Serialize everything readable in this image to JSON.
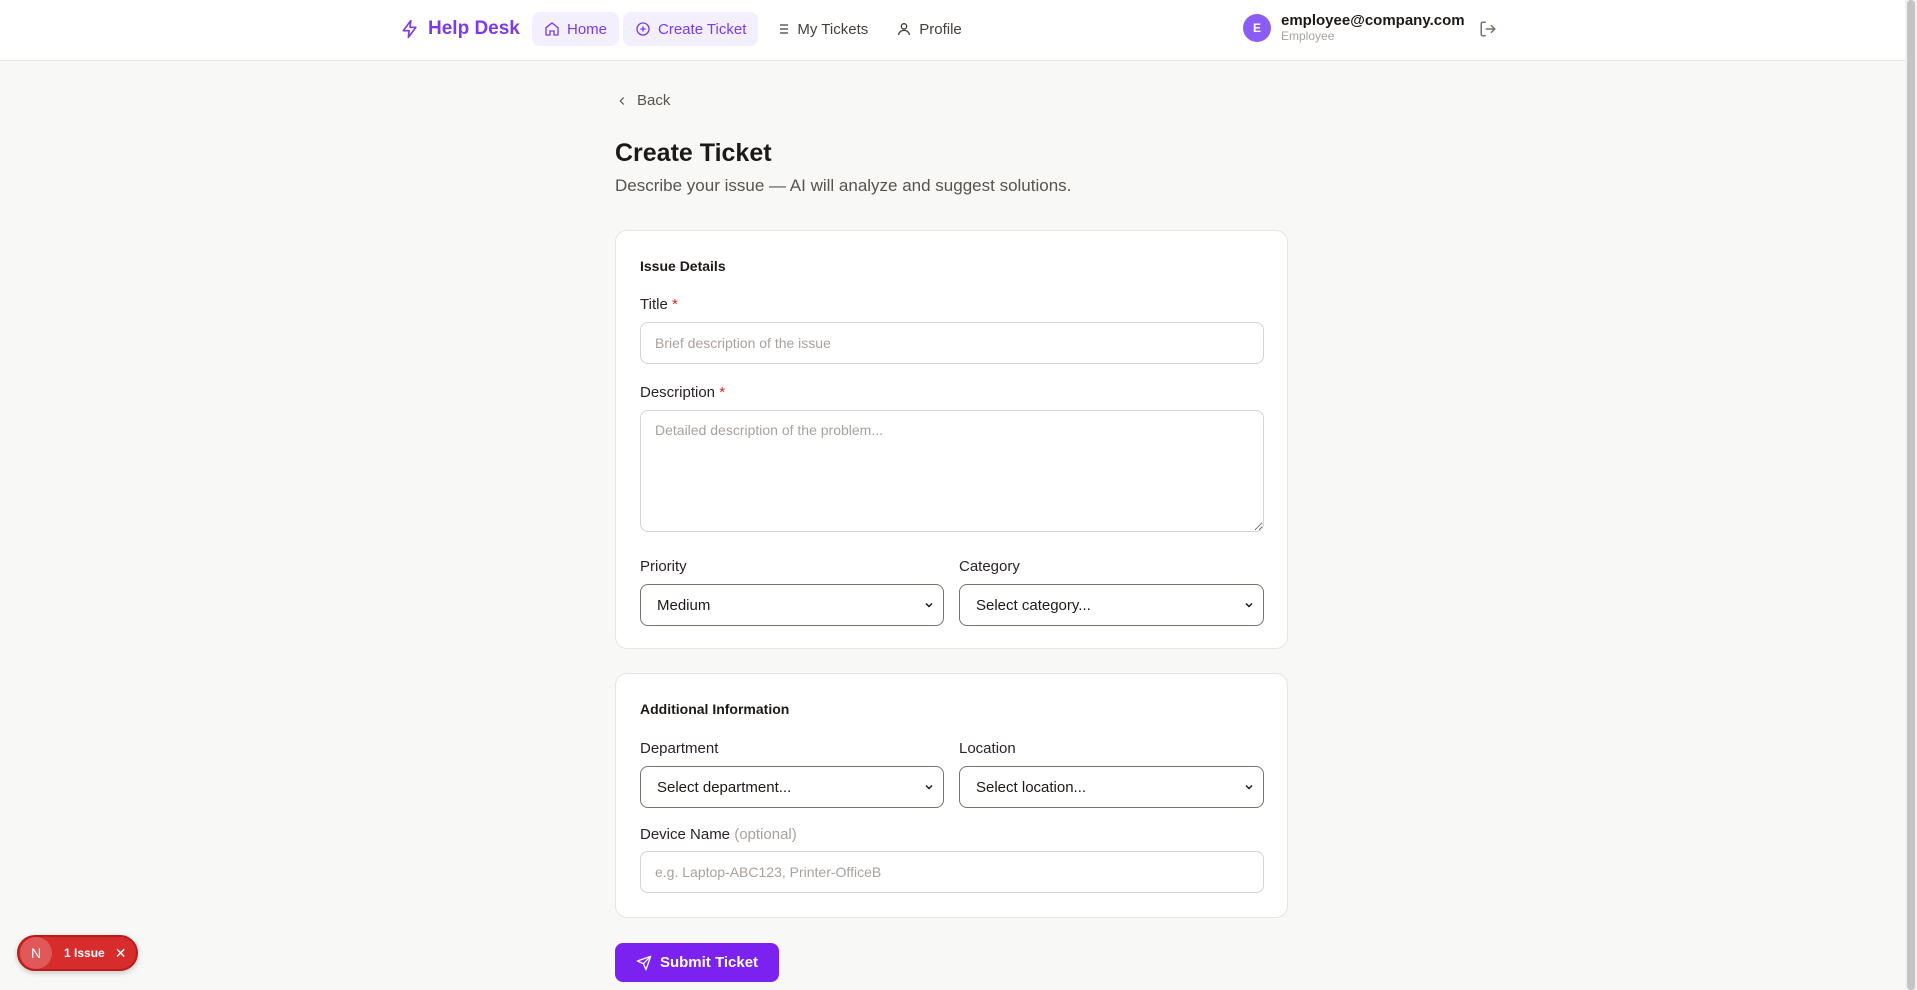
{
  "header": {
    "brand": "Help Desk",
    "nav": [
      {
        "label": "Home"
      },
      {
        "label": "Create Ticket"
      },
      {
        "label": "My Tickets"
      },
      {
        "label": "Profile"
      }
    ],
    "user": {
      "initial": "E",
      "email": "employee@company.com",
      "role": "Employee"
    }
  },
  "page": {
    "back": "Back",
    "title": "Create Ticket",
    "subtitle": "Describe your issue — AI will analyze and suggest solutions."
  },
  "issue_details": {
    "heading": "Issue Details",
    "title_label": "Title",
    "title_placeholder": "Brief description of the issue",
    "description_label": "Description",
    "description_placeholder": "Detailed description of the problem...",
    "required_mark": "*",
    "priority_label": "Priority",
    "priority_value": "Medium",
    "category_label": "Category",
    "category_value": "Select category..."
  },
  "additional": {
    "heading": "Additional Information",
    "department_label": "Department",
    "department_value": "Select department...",
    "location_label": "Location",
    "location_value": "Select location...",
    "device_label": "Device Name",
    "device_optional": "(optional)",
    "device_placeholder": "e.g. Laptop-ABC123, Printer-OfficeB"
  },
  "submit_label": "Submit Ticket",
  "issue_badge": {
    "letter": "N",
    "text": "1 Issue",
    "close": "✕"
  },
  "colors": {
    "accent": "#7c3aed",
    "button": "#7c22f0",
    "error": "#d72c2c"
  }
}
